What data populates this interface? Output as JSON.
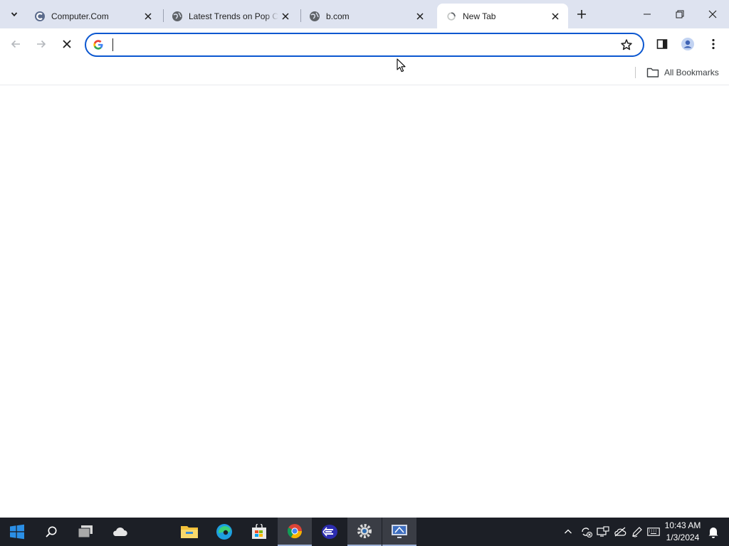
{
  "browser": {
    "tabs": [
      {
        "title": "Computer.Com",
        "favicon": "edge-c-icon",
        "active": false
      },
      {
        "title": "Latest Trends on Pop Culture",
        "favicon": "globe-icon",
        "active": false
      },
      {
        "title": "b.com",
        "favicon": "globe-icon",
        "active": false
      },
      {
        "title": "New Tab",
        "favicon": "loading-icon",
        "active": true
      }
    ],
    "omnibox": {
      "value": "",
      "placeholder": ""
    },
    "bookmarks": {
      "all_bookmarks_label": "All Bookmarks"
    }
  },
  "taskbar": {
    "apps": [
      "start-icon",
      "search-icon",
      "task-view-icon",
      "weather-icon",
      "file-explorer-icon",
      "edge-icon",
      "store-icon",
      "chrome-icon",
      "app-e-icon",
      "settings-icon",
      "remote-desktop-icon"
    ],
    "clock": {
      "time": "10:43 AM",
      "date": "1/3/2024"
    }
  },
  "colors": {
    "tabstrip": "#dee3f0",
    "accent": "#0b57d0",
    "taskbar": "#1c1f26"
  }
}
